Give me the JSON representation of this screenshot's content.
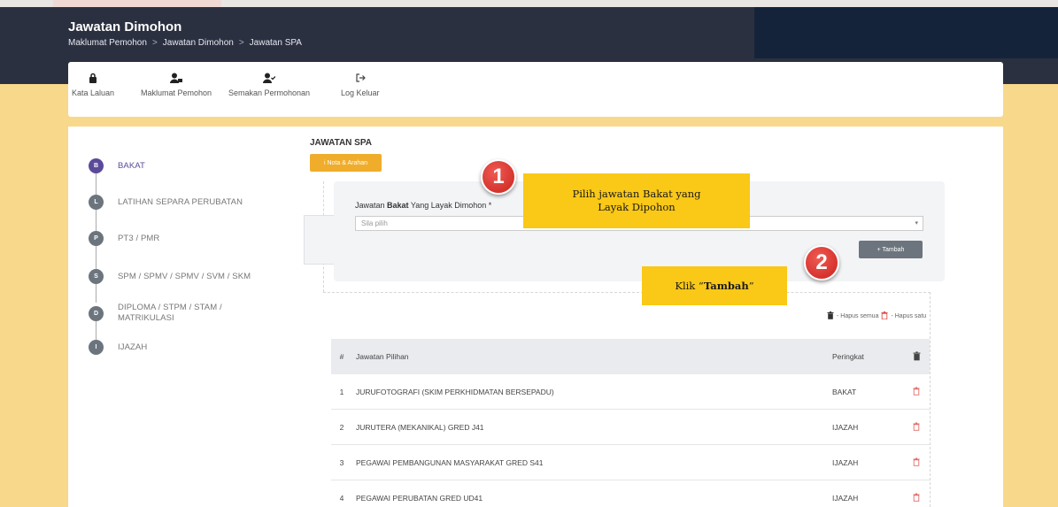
{
  "header": {
    "title": "Jawatan Dimohon",
    "breadcrumb": [
      "Maklumat Pemohon",
      "Jawatan Dimohon",
      "Jawatan SPA"
    ],
    "separator": ">"
  },
  "nav": {
    "items": [
      {
        "label": "Kata Laluan",
        "icon": "lock-icon"
      },
      {
        "label": "Maklumat Pemohon",
        "icon": "user-card-icon"
      },
      {
        "label": "Semakan Permohonan",
        "icon": "user-check-icon"
      },
      {
        "label": "Log Keluar",
        "icon": "logout-icon"
      }
    ]
  },
  "stepper": [
    {
      "letter": "B",
      "label": "BAKAT",
      "active": true
    },
    {
      "letter": "L",
      "label": "LATIHAN SEPARA PERUBATAN",
      "active": false
    },
    {
      "letter": "P",
      "label": "PT3 / PMR",
      "active": false
    },
    {
      "letter": "S",
      "label": "SPM / SPMV / SPMV / SVM / SKM",
      "active": false
    },
    {
      "letter": "D",
      "label": "DIPLOMA / STPM / STAM /",
      "label2": "MATRIKULASI",
      "active": false
    },
    {
      "letter": "I",
      "label": "IJAZAH",
      "active": false
    }
  ],
  "section": {
    "title": "JAWATAN SPA",
    "nota_button": "i Nota & Arahan",
    "field_label_pre": "Jawatan ",
    "field_label_bold": "Bakat",
    "field_label_post": " Yang Layak Dimohon *",
    "select_placeholder": "Sila pilih",
    "tambah_button": "+ Tambah",
    "hapus_semua": "- Hapus semua",
    "hapus_satu": "- Hapus satu"
  },
  "table": {
    "headers": {
      "num": "#",
      "name": "Jawatan Pilihan",
      "rank": "Peringkat"
    },
    "rows": [
      {
        "num": "1",
        "name": "JURUFOTOGRAFI (SKIM PERKHIDMATAN BERSEPADU)",
        "rank": "BAKAT"
      },
      {
        "num": "2",
        "name": "JURUTERA (MEKANIKAL) GRED J41",
        "rank": "IJAZAH"
      },
      {
        "num": "3",
        "name": "PEGAWAI PEMBANGUNAN MASYARAKAT GRED S41",
        "rank": "IJAZAH"
      },
      {
        "num": "4",
        "name": "PEGAWAI PERUBATAN GRED UD41",
        "rank": "IJAZAH"
      }
    ]
  },
  "annotations": {
    "badge1": "1",
    "badge2": "2",
    "callout1_line1": "Pilih jawatan Bakat yang",
    "callout1_line2": "Layak Dipohon",
    "callout2_pre": "Klik “",
    "callout2_bold": "Tambah",
    "callout2_post": "”"
  },
  "colors": {
    "header_bg": "#2b3041",
    "page_bg": "#f8d88a",
    "accent_orange": "#f0ad2c",
    "callout_yellow": "#fac816",
    "badge_red": "#d9342c",
    "active_step": "#5b4a9a"
  }
}
